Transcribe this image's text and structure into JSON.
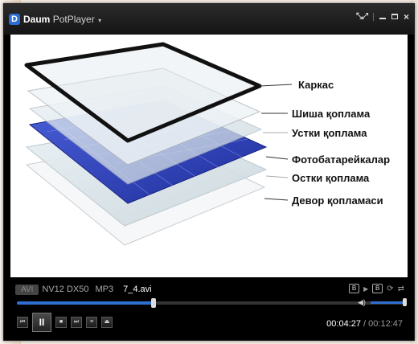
{
  "window": {
    "app_name_bold": "Daum",
    "app_name_rest": "PotPlayer",
    "logo_letter": "D"
  },
  "video": {
    "labels": [
      "Каркас",
      "Шиша қоплама",
      "Устки қоплама",
      "Фотобатарейкалар",
      "Остки қоплама",
      "Девор қопламаси"
    ]
  },
  "info": {
    "container": "AVI",
    "codec": "NV12 DX50",
    "audio": "MP3",
    "filename": "7_4.avi",
    "box_a": "B",
    "box_b": "B"
  },
  "playback": {
    "progress_fraction": 0.354,
    "volume_fraction": 1.0,
    "current_time": "00:04:27",
    "separator": " / ",
    "total_time": "00:12:47"
  },
  "colors": {
    "accent": "#2f6fcf",
    "cell_blue": "#2e3fb8"
  }
}
